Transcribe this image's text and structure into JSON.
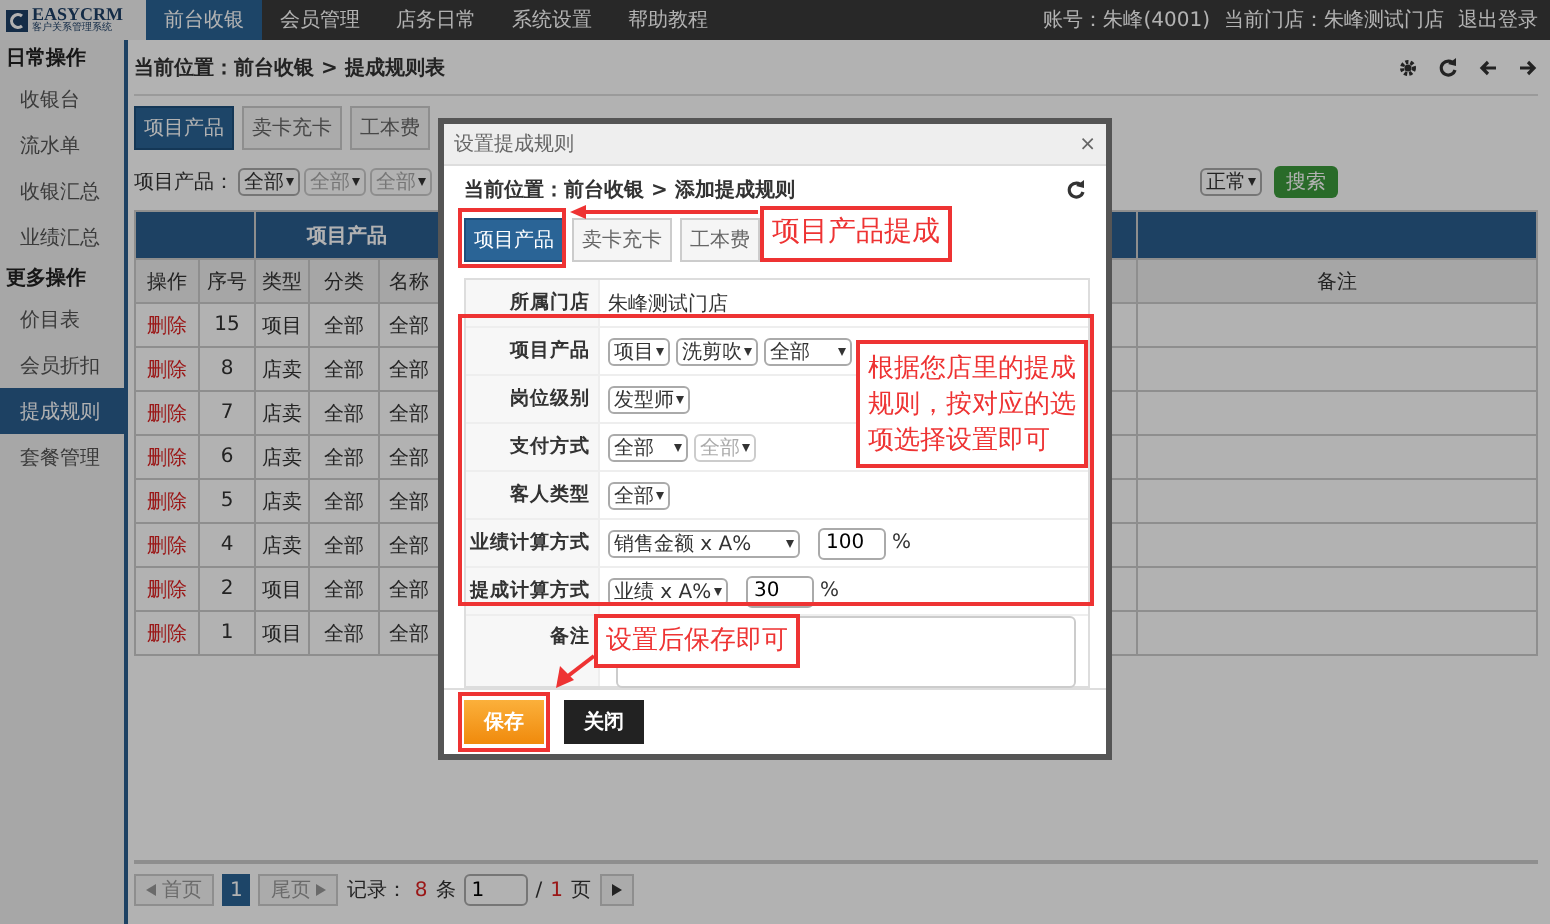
{
  "logo": {
    "title": "EASYCRM",
    "subtitle": "客户关系管理系统"
  },
  "nav": [
    {
      "label": "前台收银",
      "selected": true
    },
    {
      "label": "会员管理",
      "selected": false
    },
    {
      "label": "店务日常",
      "selected": false
    },
    {
      "label": "系统设置",
      "selected": false
    },
    {
      "label": "帮助教程",
      "selected": false
    }
  ],
  "account": {
    "user": "账号：朱峰(4001)",
    "store": "当前门店：朱峰测试门店",
    "logout": "退出登录"
  },
  "sidebar": [
    {
      "title": "日常操作",
      "items": [
        {
          "label": "收银台",
          "selected": false
        },
        {
          "label": "流水单",
          "selected": false
        },
        {
          "label": "收银汇总",
          "selected": false
        },
        {
          "label": "业绩汇总",
          "selected": false
        }
      ]
    },
    {
      "title": "更多操作",
      "items": [
        {
          "label": "价目表",
          "selected": false
        },
        {
          "label": "会员折扣",
          "selected": false
        },
        {
          "label": "提成规则",
          "selected": true
        },
        {
          "label": "套餐管理",
          "selected": false
        }
      ]
    }
  ],
  "breadcrumb": "当前位置：前台收银 > 提成规则表",
  "tabs": [
    {
      "label": "项目产品",
      "selected": true
    },
    {
      "label": "卖卡充卡",
      "selected": false
    },
    {
      "label": "工本费",
      "selected": false
    }
  ],
  "filters": {
    "label": "项目产品：",
    "selects": [
      {
        "value": "全部",
        "disabled": false
      },
      {
        "value": "全部",
        "disabled": true
      },
      {
        "value": "全部",
        "disabled": true
      }
    ],
    "status_select": "正常",
    "search_button": "搜索"
  },
  "table": {
    "group_header": "项目产品",
    "columns": [
      "操作",
      "序号",
      "类型",
      "分类",
      "名称"
    ],
    "remark_column": "备注",
    "rows": [
      {
        "action": "删除",
        "no": "15",
        "type": "项目",
        "category": "全部",
        "name": "全部"
      },
      {
        "action": "删除",
        "no": "8",
        "type": "店卖",
        "category": "全部",
        "name": "全部"
      },
      {
        "action": "删除",
        "no": "7",
        "type": "店卖",
        "category": "全部",
        "name": "全部"
      },
      {
        "action": "删除",
        "no": "6",
        "type": "店卖",
        "category": "全部",
        "name": "全部"
      },
      {
        "action": "删除",
        "no": "5",
        "type": "店卖",
        "category": "全部",
        "name": "全部"
      },
      {
        "action": "删除",
        "no": "4",
        "type": "店卖",
        "category": "全部",
        "name": "全部"
      },
      {
        "action": "删除",
        "no": "2",
        "type": "项目",
        "category": "全部",
        "name": "全部"
      },
      {
        "action": "删除",
        "no": "1",
        "type": "项目",
        "category": "全部",
        "name": "全部"
      }
    ]
  },
  "pagination": {
    "first": "首页",
    "current": "1",
    "last": "尾页",
    "record_label": "记录：",
    "record_count": "8",
    "record_unit": "条",
    "page_input": "1",
    "slash": "/",
    "total_pages": "1",
    "page_unit": "页"
  },
  "modal": {
    "title": "设置提成规则",
    "close": "×",
    "breadcrumb": "当前位置：前台收银 > 添加提成规则",
    "tabs": [
      {
        "label": "项目产品",
        "selected": true
      },
      {
        "label": "卖卡充卡",
        "selected": false
      },
      {
        "label": "工本费",
        "selected": false
      }
    ],
    "rows": [
      {
        "kind": "text",
        "label": "所属门店",
        "value": "朱峰测试门店"
      },
      {
        "kind": "selects",
        "label": "项目产品",
        "selects": [
          {
            "value": "项目",
            "disabled": false
          },
          {
            "value": "洗剪吹",
            "disabled": false
          },
          {
            "value": "全部",
            "disabled": false
          }
        ]
      },
      {
        "kind": "selects",
        "label": "岗位级别",
        "selects": [
          {
            "value": "发型师",
            "disabled": false
          }
        ]
      },
      {
        "kind": "selects",
        "label": "支付方式",
        "selects": [
          {
            "value": "全部",
            "disabled": false
          },
          {
            "value": "全部",
            "disabled": true
          }
        ]
      },
      {
        "kind": "selects",
        "label": "客人类型",
        "selects": [
          {
            "value": "全部",
            "disabled": false
          }
        ]
      },
      {
        "kind": "formula",
        "label": "业绩计算方式",
        "select": "销售金额 x A%",
        "input": "100",
        "unit": "%"
      },
      {
        "kind": "formula",
        "label": "提成计算方式",
        "select": "业绩 x A%",
        "input": "30",
        "unit": "%"
      },
      {
        "kind": "textarea",
        "label": "备注"
      }
    ],
    "save_button": "保存",
    "close_button": "关闭"
  },
  "annotations": [
    {
      "text": "项目产品提成"
    },
    {
      "text": "根据您店里的提成规则，按对应的选项选择设置即可"
    },
    {
      "text": "设置后保存即可"
    }
  ]
}
